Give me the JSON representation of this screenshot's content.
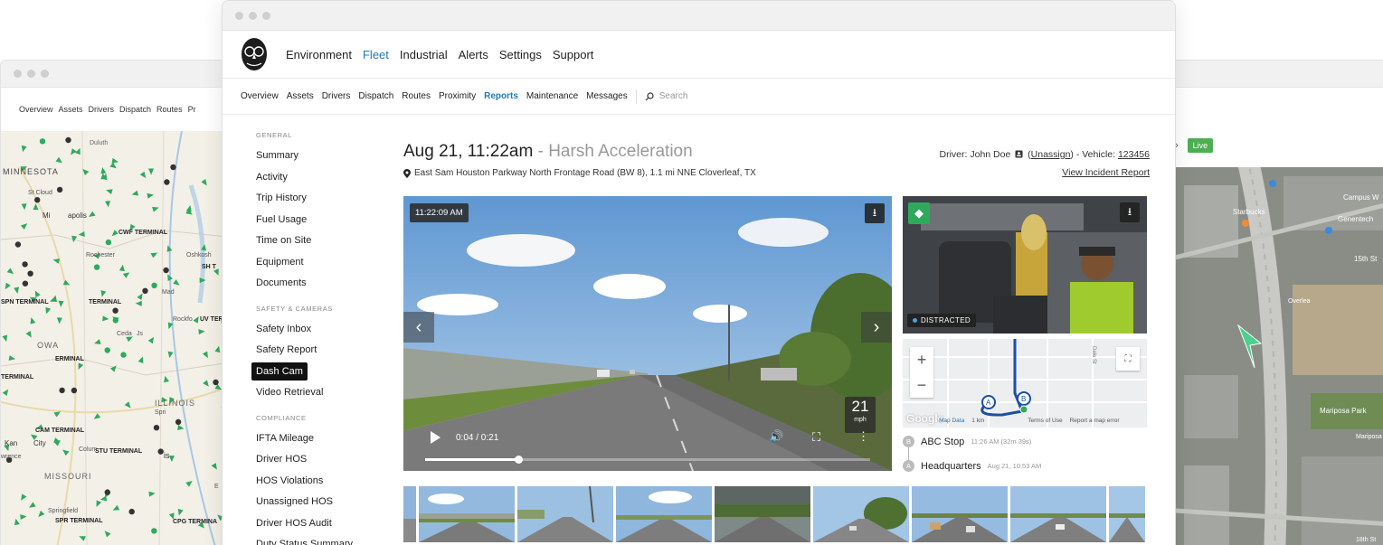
{
  "left_window": {
    "nav": [
      "Overview",
      "Assets",
      "Drivers",
      "Dispatch",
      "Routes",
      "Pr"
    ],
    "map_labels": [
      "Duluth",
      "MINNESOTA",
      "St Cloud",
      "Mi",
      "apolis",
      "CWF TERMINAL",
      "Rochester",
      "Oshkosh",
      "SH T",
      "SPN TERMINAL",
      "TERMINAL",
      "Mad",
      "Rockfo",
      "UV TERM",
      "Ceda",
      "Js",
      "OWA",
      "ERMINAL",
      "TERMINAL",
      "Spri",
      "ILLINOIS",
      "CAM TERMINAL",
      "Kan",
      "City",
      "Colum",
      "STU TERMINAL",
      "is",
      "MISSOURI",
      "Springfield",
      "SPR TERMINAL",
      "CPG TERMINA",
      "E",
      "wrence"
    ]
  },
  "right_window": {
    "live_label": "Live",
    "map_labels": [
      "Starbucks",
      "Genentech",
      "Campus W",
      "15th St",
      "Mariposa Park",
      "Mariposa",
      "18th St",
      "Overlea"
    ]
  },
  "topnav": {
    "items": [
      "Environment",
      "Fleet",
      "Industrial",
      "Alerts",
      "Settings",
      "Support"
    ],
    "active_index": 1
  },
  "subnav": {
    "items": [
      "Overview",
      "Assets",
      "Drivers",
      "Dispatch",
      "Routes",
      "Proximity",
      "Reports",
      "Maintenance",
      "Messages"
    ],
    "active_index": 6,
    "search_placeholder": "Search"
  },
  "sidebar": {
    "sections": [
      {
        "heading": "GENERAL",
        "items": [
          "Summary",
          "Activity",
          "Trip History",
          "Fuel Usage",
          "Time on Site",
          "Equipment",
          "Documents"
        ]
      },
      {
        "heading": "SAFETY & CAMERAS",
        "items": [
          "Safety Inbox",
          "Safety Report",
          "Dash Cam",
          "Video Retrieval"
        ]
      },
      {
        "heading": "COMPLIANCE",
        "items": [
          "IFTA Mileage",
          "Driver HOS",
          "HOS Violations",
          "Unassigned HOS",
          "Driver HOS Audit",
          "Duty Status Summary"
        ]
      }
    ],
    "active_item": "Dash Cam"
  },
  "incident": {
    "datetime": "Aug 21, 11:22am",
    "separator": " - ",
    "event": "Harsh Acceleration",
    "location": "East Sam Houston Parkway North Frontage Road (BW 8), 1.1 mi NNE Cloverleaf, TX",
    "driver_label": "Driver: John Doe",
    "unassign": "Unassign",
    "vehicle_label": " - Vehicle: ",
    "vehicle_id": "123456",
    "view_report": "View Incident Report"
  },
  "video": {
    "timestamp": "11:22:09 AM",
    "time_display": "0:04 / 0:21",
    "progress_fraction": 0.21,
    "speed_value": "21",
    "speed_unit": "mph"
  },
  "cabin": {
    "status": "DISTRACTED"
  },
  "minimap": {
    "google": "Google",
    "map_data": "Map Data",
    "scale": "1 km",
    "terms": "Terms of Use",
    "report_error": "Report a map error",
    "street_labels": [
      "Dale St"
    ]
  },
  "stops": [
    {
      "badge": "B",
      "name": "ABC Stop",
      "time": "11:26 AM (32m 39s)"
    },
    {
      "badge": "A",
      "name": "Headquarters",
      "time": "Aug 21, 10:53 AM"
    }
  ],
  "colors": {
    "accent": "#1f7ab8",
    "map_green": "#2eaa5b",
    "live_green": "#4caf50"
  },
  "icons": [
    "owl-logo-icon",
    "search-icon",
    "pin-icon",
    "id-card-icon",
    "download-icon",
    "chevron-left-icon",
    "chevron-right-icon",
    "play-icon",
    "volume-icon",
    "fullscreen-icon",
    "more-icon",
    "layers-icon",
    "zoom-in-icon",
    "zoom-out-icon",
    "expand-icon"
  ]
}
